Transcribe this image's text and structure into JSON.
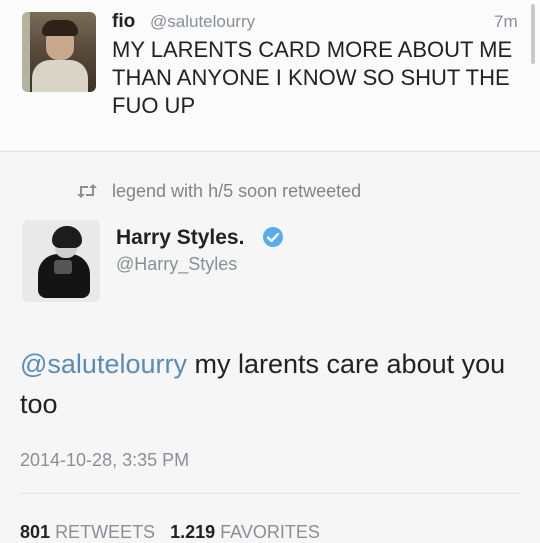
{
  "top_tweet": {
    "name": "fio",
    "handle": "@salutelourry",
    "time": "7m",
    "text": "MY LARENTS CARD MORE ABOUT ME THAN ANYONE I KNOW SO SHUT THE FUO UP"
  },
  "retweet_context": {
    "icon": "retweet-icon",
    "text": "legend with h/5 soon retweeted"
  },
  "main_tweet": {
    "name": "Harry Styles.",
    "verified_icon": "verified-badge-icon",
    "handle": "@Harry_Styles",
    "mention": "@salutelourry",
    "text": " my larents care about you too",
    "timestamp": "2014-10-28, 3:35 PM",
    "retweets_count": "801",
    "retweets_label": "RETWEETS",
    "favorites_count": "1.219",
    "favorites_label": "FAVORITES"
  },
  "colors": {
    "link": "#5b8bb7",
    "verified": "#55acee",
    "muted": "#8a8f96"
  }
}
